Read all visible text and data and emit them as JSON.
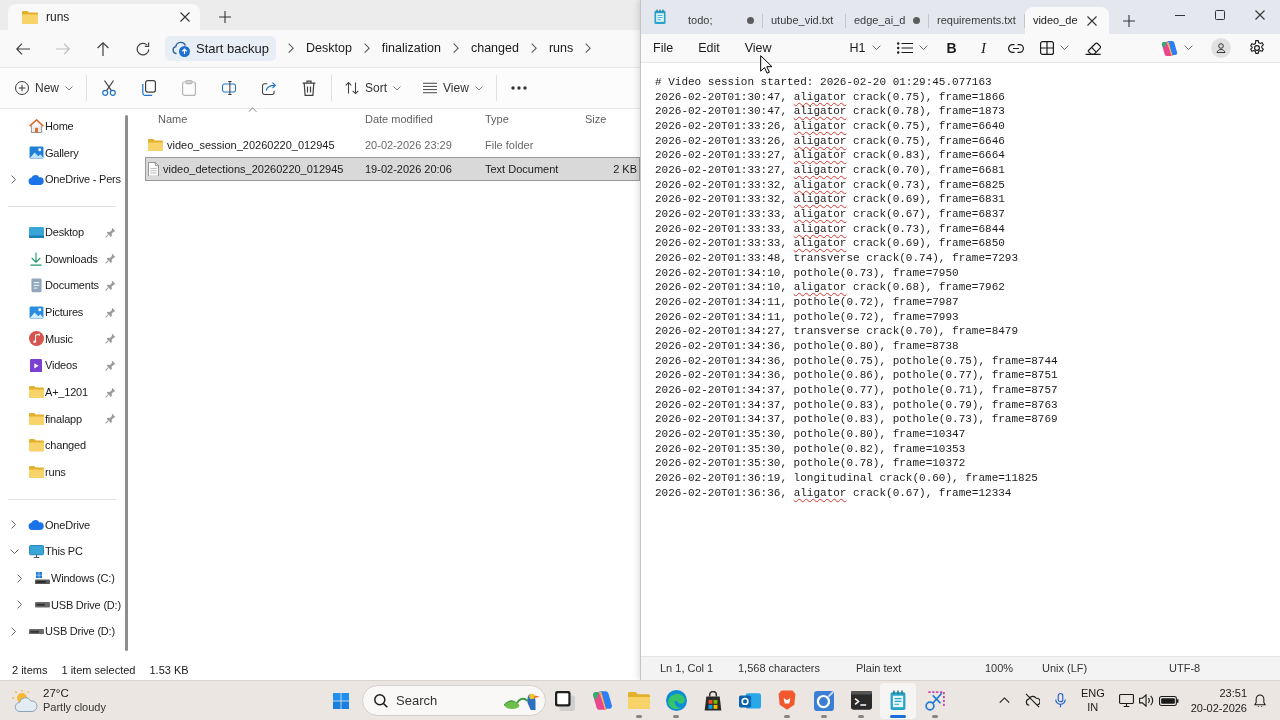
{
  "explorer": {
    "tabs": [
      {
        "title": "runs",
        "selected": true
      }
    ],
    "nav_buttons": [
      {
        "kind": "back",
        "disabled": false
      },
      {
        "kind": "forward",
        "disabled": true
      },
      {
        "kind": "up",
        "disabled": false
      },
      {
        "kind": "refresh",
        "disabled": false
      }
    ],
    "backup_button": {
      "label": "Start backup"
    },
    "path": [
      "Desktop",
      "finalization",
      "changed",
      "runs"
    ],
    "toolbar": [
      [
        {
          "kind": "new",
          "label": "New",
          "disabled": false
        }
      ],
      [
        {
          "kind": "cut",
          "disabled": false
        },
        {
          "kind": "copy",
          "disabled": false
        },
        {
          "kind": "paste",
          "disabled": true
        },
        {
          "kind": "rename",
          "disabled": false
        },
        {
          "kind": "share",
          "disabled": false
        },
        {
          "kind": "delete",
          "disabled": false
        }
      ],
      [
        {
          "kind": "sort",
          "label": "Sort",
          "disabled": false
        },
        {
          "kind": "view",
          "label": "View",
          "disabled": false
        }
      ],
      [
        {
          "kind": "more",
          "disabled": false
        }
      ]
    ],
    "sidebar": {
      "sections": [
        [
          {
            "label": "Home",
            "kind": "home",
            "pinned": false
          },
          {
            "label": "Gallery",
            "kind": "gallery",
            "pinned": false
          },
          {
            "label": "OneDrive - Pers",
            "kind": "cloud",
            "pinned": false,
            "expanded": false
          }
        ],
        [
          {
            "label": "Desktop",
            "kind": "desktop",
            "pinned": true
          },
          {
            "label": "Downloads",
            "kind": "downloads",
            "pinned": true
          },
          {
            "label": "Documents",
            "kind": "documents",
            "pinned": true
          },
          {
            "label": "Pictures",
            "kind": "pictures",
            "pinned": true
          },
          {
            "label": "Music",
            "kind": "music",
            "pinned": true
          },
          {
            "label": "Videos",
            "kind": "videos",
            "pinned": true
          },
          {
            "label": "A+_1201",
            "kind": "folder",
            "pinned": true
          },
          {
            "label": "finalapp",
            "kind": "folder",
            "pinned": true
          },
          {
            "label": "changed",
            "kind": "folder",
            "pinned": false
          },
          {
            "label": "runs",
            "kind": "folder",
            "pinned": false
          }
        ],
        [
          {
            "label": "OneDrive",
            "kind": "cloud",
            "pinned": false,
            "expanded": false
          },
          {
            "label": "This PC",
            "kind": "pc",
            "pinned": false,
            "expanded": true,
            "children": [
              {
                "label": "Windows (C:)",
                "kind": "windows_drive",
                "pinned": false,
                "expanded": false
              },
              {
                "label": "USB Drive (D:)",
                "kind": "usb_drive",
                "pinned": false,
                "expanded": false
              }
            ]
          },
          {
            "label": "USB Drive (D:)",
            "kind": "usb_drive",
            "pinned": false,
            "expanded": false
          }
        ]
      ]
    },
    "columns": [
      {
        "label": "Name",
        "sorted": true
      },
      {
        "label": "Date modified",
        "sorted": false
      },
      {
        "label": "Type",
        "sorted": false
      },
      {
        "label": "Size",
        "sorted": false
      }
    ],
    "files": [
      {
        "kind": "folder",
        "name": "video_session_20260220_012945",
        "date_modified": "20-02-2026 23:29",
        "type": "File folder",
        "selected": false
      },
      {
        "kind": "text",
        "name": "video_detections_20260220_012945",
        "date_modified": "19-02-2026 20:06",
        "type": "Text Document",
        "size": "2 KB",
        "selected": true
      }
    ],
    "status_bar": [
      "2 items",
      "1 item selected",
      "1.53 KB"
    ]
  },
  "notepad": {
    "tabs": [
      {
        "title": "todo;",
        "unsaved": true,
        "selected": false
      },
      {
        "title": "utube_vid.txt",
        "unsaved": false,
        "selected": false
      },
      {
        "title": "edge_ai_d",
        "unsaved": true,
        "selected": false
      },
      {
        "title": "requirements.txt",
        "unsaved": false,
        "selected": false
      },
      {
        "title": "video_de",
        "unsaved": false,
        "selected": true
      }
    ],
    "menu": [
      "File",
      "Edit",
      "View"
    ],
    "format_toolbar": [
      {
        "kind": "heading",
        "label": "H1"
      },
      {
        "kind": "list"
      },
      {
        "kind": "bold",
        "label": "B"
      },
      {
        "kind": "italic",
        "label": "I"
      },
      {
        "kind": "link"
      },
      {
        "kind": "table"
      },
      {
        "kind": "spellcheck"
      }
    ],
    "lines": [
      [
        {
          "text": "# Video session started: 2026-02-20 01:29:45.077163",
          "misspelled": false
        }
      ],
      [
        {
          "text": "2026-02-20T01:30:47, ",
          "misspelled": false
        },
        {
          "text": "aligator",
          "misspelled": true
        },
        {
          "text": " crack(0.75), frame=1866",
          "misspelled": false
        }
      ],
      [
        {
          "text": "2026-02-20T01:30:47, ",
          "misspelled": false
        },
        {
          "text": "aligator",
          "misspelled": true
        },
        {
          "text": " crack(0.78), frame=1873",
          "misspelled": false
        }
      ],
      [
        {
          "text": "2026-02-20T01:33:26, ",
          "misspelled": false
        },
        {
          "text": "aligator",
          "misspelled": true
        },
        {
          "text": " crack(0.75), frame=6640",
          "misspelled": false
        }
      ],
      [
        {
          "text": "2026-02-20T01:33:26, ",
          "misspelled": false
        },
        {
          "text": "aligator",
          "misspelled": true
        },
        {
          "text": " crack(0.75), frame=6646",
          "misspelled": false
        }
      ],
      [
        {
          "text": "2026-02-20T01:33:27, ",
          "misspelled": false
        },
        {
          "text": "aligator",
          "misspelled": true
        },
        {
          "text": " crack(0.83), frame=6664",
          "misspelled": false
        }
      ],
      [
        {
          "text": "2026-02-20T01:33:27, ",
          "misspelled": false
        },
        {
          "text": "aligator",
          "misspelled": true
        },
        {
          "text": " crack(0.70), frame=6681",
          "misspelled": false
        }
      ],
      [
        {
          "text": "2026-02-20T01:33:32, ",
          "misspelled": false
        },
        {
          "text": "aligator",
          "misspelled": true
        },
        {
          "text": " crack(0.73), frame=6825",
          "misspelled": false
        }
      ],
      [
        {
          "text": "2026-02-20T01:33:32, ",
          "misspelled": false
        },
        {
          "text": "aligator",
          "misspelled": true
        },
        {
          "text": " crack(0.69), frame=6831",
          "misspelled": false
        }
      ],
      [
        {
          "text": "2026-02-20T01:33:33, ",
          "misspelled": false
        },
        {
          "text": "aligator",
          "misspelled": true
        },
        {
          "text": " crack(0.67), frame=6837",
          "misspelled": false
        }
      ],
      [
        {
          "text": "2026-02-20T01:33:33, ",
          "misspelled": false
        },
        {
          "text": "aligator",
          "misspelled": true
        },
        {
          "text": " crack(0.73), frame=6844",
          "misspelled": false
        }
      ],
      [
        {
          "text": "2026-02-20T01:33:33, ",
          "misspelled": false
        },
        {
          "text": "aligator",
          "misspelled": true
        },
        {
          "text": " crack(0.69), frame=6850",
          "misspelled": false
        }
      ],
      [
        {
          "text": "2026-02-20T01:33:48, transverse crack(0.74), frame=7293",
          "misspelled": false
        }
      ],
      [
        {
          "text": "2026-02-20T01:34:10, pothole(0.73), frame=7950",
          "misspelled": false
        }
      ],
      [
        {
          "text": "2026-02-20T01:34:10, ",
          "misspelled": false
        },
        {
          "text": "aligator",
          "misspelled": true
        },
        {
          "text": " crack(0.68), frame=7962",
          "misspelled": false
        }
      ],
      [
        {
          "text": "2026-02-20T01:34:11, pothole(0.72), frame=7987",
          "misspelled": false
        }
      ],
      [
        {
          "text": "2026-02-20T01:34:11, pothole(0.72), frame=7993",
          "misspelled": false
        }
      ],
      [
        {
          "text": "2026-02-20T01:34:27, transverse crack(0.70), frame=8479",
          "misspelled": false
        }
      ],
      [
        {
          "text": "2026-02-20T01:34:36, pothole(0.80), frame=8738",
          "misspelled": false
        }
      ],
      [
        {
          "text": "2026-02-20T01:34:36, pothole(0.75), pothole(0.75), frame=8744",
          "misspelled": false
        }
      ],
      [
        {
          "text": "2026-02-20T01:34:36, pothole(0.86), pothole(0.77), frame=8751",
          "misspelled": false
        }
      ],
      [
        {
          "text": "2026-02-20T01:34:37, pothole(0.77), pothole(0.71), frame=8757",
          "misspelled": false
        }
      ],
      [
        {
          "text": "2026-02-20T01:34:37, pothole(0.83), pothole(0.79), frame=8763",
          "misspelled": false
        }
      ],
      [
        {
          "text": "2026-02-20T01:34:37, pothole(0.83), pothole(0.73), frame=8769",
          "misspelled": false
        }
      ],
      [
        {
          "text": "2026-02-20T01:35:30, pothole(0.80), frame=10347",
          "misspelled": false
        }
      ],
      [
        {
          "text": "2026-02-20T01:35:30, pothole(0.82), frame=10353",
          "misspelled": false
        }
      ],
      [
        {
          "text": "2026-02-20T01:35:30, pothole(0.78), frame=10372",
          "misspelled": false
        }
      ],
      [
        {
          "text": "2026-02-20T01:36:19, longitudinal crack(0.60), frame=11825",
          "misspelled": false
        }
      ],
      [
        {
          "text": "2026-02-20T01:36:36, ",
          "misspelled": false
        },
        {
          "text": "aligator",
          "misspelled": true
        },
        {
          "text": " crack(0.67), frame=12334",
          "misspelled": false
        }
      ]
    ],
    "status_bar": [
      "Ln 1, Col 1",
      "1,568 characters",
      "Plain text",
      "100%",
      "Unix (LF)",
      "UTF-8"
    ]
  },
  "taskbar": {
    "weather": {
      "temperature": "27°C",
      "condition": "Partly cloudy"
    },
    "search": {
      "placeholder": "Search"
    },
    "apps": [
      {
        "kind": "window",
        "running": false,
        "active": false
      },
      {
        "kind": "assistant",
        "running": false,
        "active": false
      },
      {
        "kind": "files",
        "running": true,
        "active": false
      },
      {
        "kind": "browser",
        "running": true,
        "active": false
      },
      {
        "kind": "store",
        "running": false,
        "active": false
      },
      {
        "kind": "mail",
        "running": false,
        "active": false
      },
      {
        "kind": "shield",
        "running": true,
        "active": false
      },
      {
        "kind": "tile",
        "running": true,
        "active": false
      },
      {
        "kind": "terminal",
        "running": true,
        "active": false
      },
      {
        "kind": "notepad",
        "running": true,
        "active": true
      },
      {
        "kind": "snipping",
        "running": true,
        "active": false
      }
    ],
    "tray": {
      "language": "ENG",
      "region": "IN",
      "time": "23:51",
      "date": "20-02-2026"
    }
  }
}
